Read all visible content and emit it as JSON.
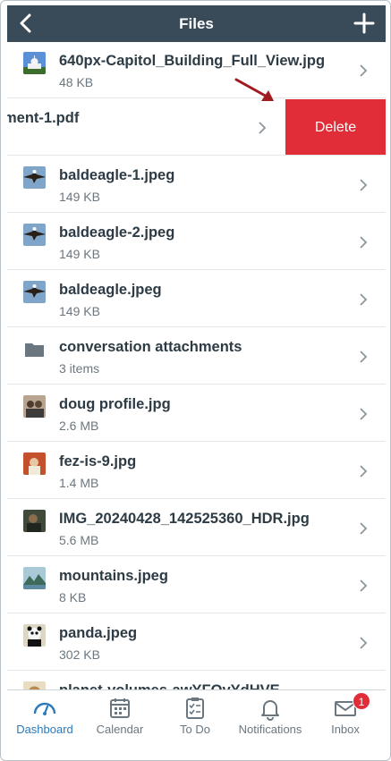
{
  "header": {
    "title": "Files",
    "back_icon": "back-chevron-icon",
    "add_icon": "plus-icon"
  },
  "files": [
    {
      "name": "640px-Capitol_Building_Full_View.jpg",
      "sub": "48 KB",
      "icon": "capitol-thumbnail"
    },
    {
      "name": "ment-1.pdf",
      "sub": "",
      "icon": "pdf-icon"
    },
    {
      "name": "baldeagle-1.jpeg",
      "sub": "149 KB",
      "icon": "eagle-thumbnail"
    },
    {
      "name": "baldeagle-2.jpeg",
      "sub": "149 KB",
      "icon": "eagle-thumbnail"
    },
    {
      "name": "baldeagle.jpeg",
      "sub": "149 KB",
      "icon": "eagle-thumbnail"
    },
    {
      "name": "conversation attachments",
      "sub": "3 items",
      "icon": "folder-icon"
    },
    {
      "name": "doug profile.jpg",
      "sub": "2.6 MB",
      "icon": "photo-thumbnail"
    },
    {
      "name": "fez-is-9.jpg",
      "sub": "1.4 MB",
      "icon": "photo-thumbnail"
    },
    {
      "name": "IMG_20240428_142525360_HDR.jpg",
      "sub": "5.6 MB",
      "icon": "photo-thumbnail"
    },
    {
      "name": "mountains.jpeg",
      "sub": "8 KB",
      "icon": "mountains-thumbnail"
    },
    {
      "name": "panda.jpeg",
      "sub": "302 KB",
      "icon": "panda-thumbnail"
    },
    {
      "name": "planet-volumes-awYFOvYdHVE-",
      "sub": "",
      "icon": "photo-thumbnail"
    }
  ],
  "swipe_action": {
    "delete_label": "Delete",
    "color": "#e12d37"
  },
  "tabbar": {
    "tabs": [
      {
        "label": "Dashboard",
        "icon": "dashboard-icon",
        "active": true
      },
      {
        "label": "Calendar",
        "icon": "calendar-icon"
      },
      {
        "label": "To Do",
        "icon": "todo-icon"
      },
      {
        "label": "Notifications",
        "icon": "bell-icon"
      },
      {
        "label": "Inbox",
        "icon": "inbox-icon",
        "badge": "1"
      }
    ]
  },
  "colors": {
    "header_bg": "#394b58",
    "accent": "#2b7abc",
    "delete": "#e12d37",
    "text": "#2d3b45",
    "subtext": "#6b7780"
  }
}
